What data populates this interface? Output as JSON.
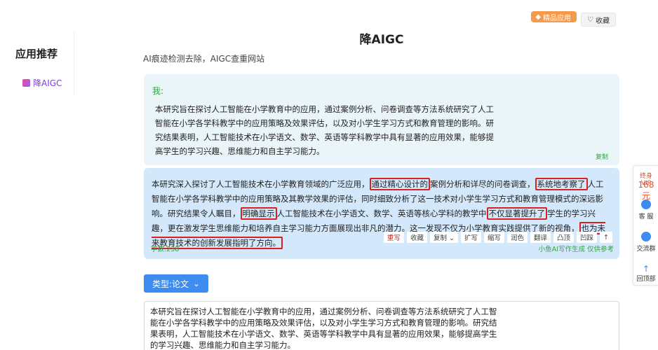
{
  "header": {
    "pro_label": "精品应用",
    "fav_label": "收藏",
    "title": "降AIGC",
    "subtitle": "AI痕迹检测去除，AIGC查重网站"
  },
  "sidebar": {
    "title": "应用推荐",
    "item": "降AIGC"
  },
  "chat": {
    "me_label": "我:",
    "me_text": "本研究旨在探讨人工智能在小学教育中的应用，通过案例分析、问卷调查等方法系统研究了人工智能在小学各学科教学中的应用策略及效果评估，以及对小学生学习方式和教育管理的影响。研究结果表明，人工智能技术在小学语文、数学、英语等学科教学中具有显著的应用效果，能够提高学生的学习兴趣、思维能力和自主学习能力。",
    "copy_label": "复制",
    "ai_text_parts": [
      "本研究深入探讨了人工智能技术在小学教育领域的广泛应用，",
      "通过精心设计的",
      "案例分析和详尽的问卷调查，",
      "系统地考察了",
      "人工智能在小学各学科教学中的应用策略及其教学效果的评估，同时细致分析了这一技术对小学生学习方式和教育管理模式的深远影响。研究结果令人瞩目，",
      "明确显示",
      "人工智能技术在小学语文、数学、英语等核心学科的教学中",
      "不仅显著提升了",
      "学生的学习兴趣，更在激发学生思维能力和培养自主学习能力方面展现出非凡的潜力。这一发现不仅为小学教育实践提供了新的视角，",
      "也为未来教育技术的创新发展指明了方向。"
    ],
    "toolbar": [
      "重写",
      "收藏",
      "复制 ⌄",
      "扩写",
      "缩写",
      "润色",
      "翻译",
      "凸顶",
      "凹踩",
      "↑"
    ],
    "word_count": "字数:238",
    "ai_note": "小鱼AI写作生成 仅供参考"
  },
  "input": {
    "type_label": "类型:论文",
    "text": "本研究旨在探讨人工智能在小学教育中的应用，通过案例分析、问卷调查等方法系统研究了人工智能在小学各学科教学中的应用策略及效果评估，以及对小学生学习方式和教育管理的影响。研究结果表明，人工智能技术在小学语文、数学、英语等学科教学中具有显著的应用效果，能够提高学生的学习兴趣、思维能力和自主学习能力。"
  },
  "float_bar": {
    "vip_label": "终身VIP",
    "vip_price": "168元",
    "service": "客 服",
    "group": "交流群",
    "top": "回顶部"
  },
  "colors": {
    "accent": "#3f8cf0",
    "green": "#3aa046",
    "highlight": "#d92020",
    "ai_bg": "#d3e8fb",
    "me_bg": "#eaf5f9"
  }
}
